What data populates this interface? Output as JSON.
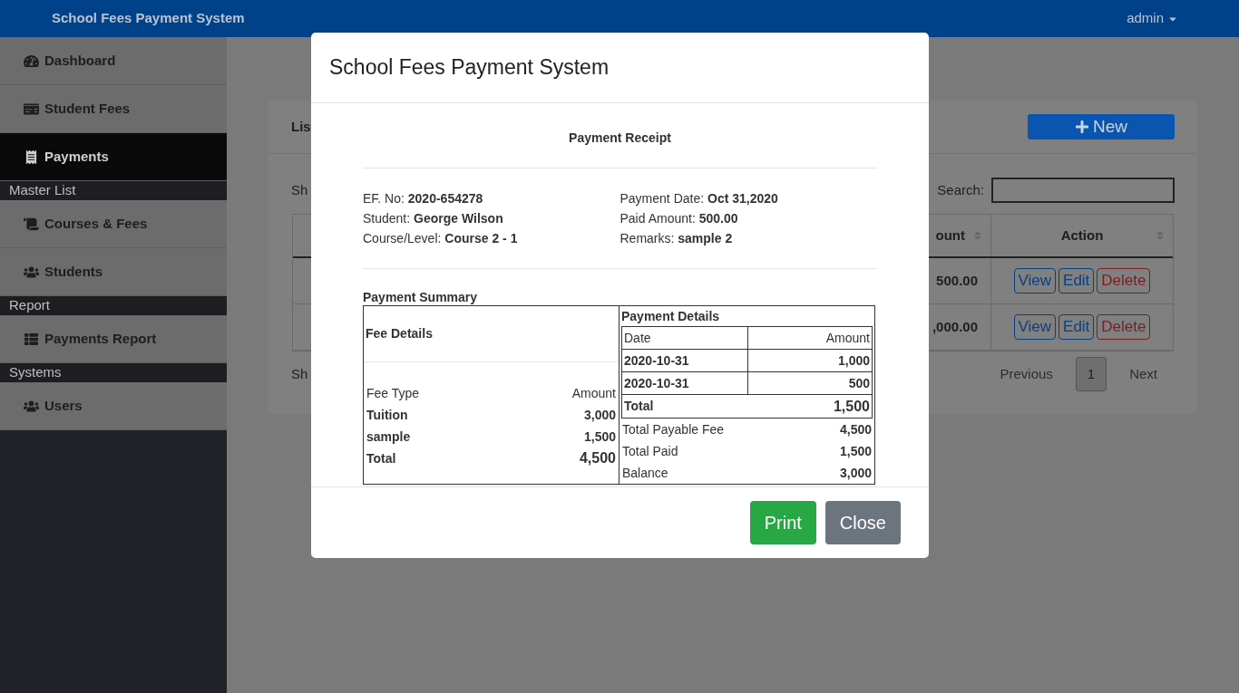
{
  "navbar": {
    "title": "School Fees Payment System",
    "user": "admin"
  },
  "sidebar": {
    "items": [
      {
        "kind": "link",
        "label": "Dashboard",
        "selected": false
      },
      {
        "kind": "link",
        "label": "Student Fees",
        "selected": false
      },
      {
        "kind": "link",
        "label": "Payments",
        "selected": true
      },
      {
        "kind": "header",
        "label": "Master List"
      },
      {
        "kind": "link",
        "label": "Courses & Fees",
        "selected": false
      },
      {
        "kind": "link",
        "label": "Students",
        "selected": false
      },
      {
        "kind": "header",
        "label": "Report"
      },
      {
        "kind": "link",
        "label": "Payments Report",
        "selected": false
      },
      {
        "kind": "header",
        "label": "Systems"
      },
      {
        "kind": "link",
        "label": "Users",
        "selected": false
      }
    ]
  },
  "card": {
    "title": "Lis",
    "new_button": "New",
    "show_top": "Sh",
    "search_label": "Search:",
    "columns": [
      "ount",
      "Action"
    ],
    "rows": [
      {
        "amount": "500.00",
        "actions": [
          "View",
          "Edit",
          "Delete"
        ]
      },
      {
        "amount": ",000.00",
        "actions": [
          "View",
          "Edit",
          "Delete"
        ]
      }
    ],
    "show_bottom": "Sh",
    "pagination": [
      {
        "label": "Previous",
        "selected": false
      },
      {
        "label": "1",
        "selected": true
      },
      {
        "label": "Next",
        "selected": false
      }
    ]
  },
  "modal": {
    "title": "School Fees Payment System",
    "receipt_title": "Payment Receipt",
    "info_left": [
      {
        "label": "EF. No:",
        "value": "2020-654278"
      },
      {
        "label": "Student:",
        "value": "George Wilson"
      },
      {
        "label": "Course/Level:",
        "value": "Course 2 - 1"
      }
    ],
    "info_right": [
      {
        "label": "Payment Date:",
        "value": "Oct 31,2020"
      },
      {
        "label": "Paid Amount:",
        "value": "500.00"
      },
      {
        "label": "Remarks:",
        "value": "sample 2"
      }
    ],
    "summary_title": "Payment Summary",
    "fee_details": {
      "title": "Fee Details",
      "columns": [
        "Fee Type",
        "Amount"
      ],
      "rows": [
        {
          "name": "Tuition",
          "amount": "3,000"
        },
        {
          "name": "sample",
          "amount": "1,500"
        }
      ],
      "total": {
        "label": "Total",
        "amount": "4,500"
      }
    },
    "payment_details": {
      "title": "Payment Details",
      "columns": [
        "Date",
        "Amount"
      ],
      "rows": [
        {
          "date": "2020-10-31",
          "amount": "1,000"
        },
        {
          "date": "2020-10-31",
          "amount": "500"
        }
      ],
      "total": {
        "label": "Total",
        "amount": "1,500"
      }
    },
    "totals": [
      {
        "label": "Total Payable Fee",
        "value": "4,500"
      },
      {
        "label": "Total Paid",
        "value": "1,500"
      },
      {
        "label": "Balance",
        "value": "3,000"
      }
    ],
    "buttons": [
      {
        "kind": "print",
        "label": "Print"
      },
      {
        "kind": "close",
        "label": "Close"
      }
    ]
  }
}
